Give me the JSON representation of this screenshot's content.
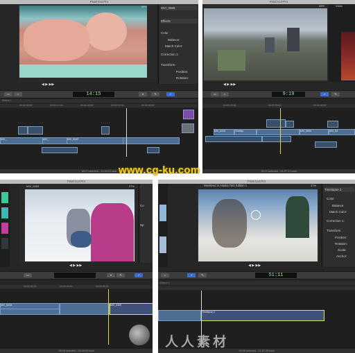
{
  "watermark": {
    "site": "www.cg-ku.com",
    "logo_text": "人人素材"
  },
  "panel_tl": {
    "app_title": "Final Cut Pro",
    "zoom": "46%",
    "inspector": {
      "clip_name": "MVI_0968",
      "section": "Effects",
      "color": "Color",
      "balance": "Balance:",
      "match": "Match Color:",
      "correction": "Correction 1:",
      "transform": "Transform",
      "position": "Position:",
      "rotation": "Rotation:"
    },
    "timecode": "14:15",
    "edition": "Edition 1",
    "ruler": [
      "00:00:00:00",
      "00:00:10:00",
      "00:00:20:00",
      "00:00:30:00",
      "00:00:40:00"
    ],
    "clips": [
      "MVI_",
      "MVI_",
      "MVI_5443"
    ],
    "status": "MVI? selected - 01:04:12 total"
  },
  "panel_tr": {
    "app_title": "Final Cut Pro",
    "zoom": "45%",
    "viewer_label": "Video",
    "timecode": "9:19",
    "ruler": [
      "00:00:20:00",
      "00:00:30:00",
      "00:00:40:00"
    ],
    "clips": [
      "MVI_5418",
      "Timelap",
      "MVI_5600",
      "MVI_54"
    ],
    "status": "26:19 selected - 01:57:12 total"
  },
  "panel_bl": {
    "app_title": "Final Cut Pro",
    "clip_label": "MVI_5469",
    "zoom": "37%",
    "timecode": "",
    "ruler": [
      "00:00:02:00",
      "00:00:04:00",
      "00:00:06:00"
    ],
    "clips": [
      "MVI_5418",
      "MVI_5469"
    ],
    "status": "26:18 selected - 02:49:53 total"
  },
  "panel_br": {
    "app_title": "Final Cut Pro",
    "project_title": "Weekend in Alaska Tutz Edition 1",
    "zoom": "37%",
    "inspector": {
      "title": "Timelapse 2",
      "color": "Color",
      "balance": "Balance:",
      "match": "Match Color:",
      "correction": "Correction 1:",
      "transform": "Transform",
      "position": "Position:",
      "rotation": "Rotation:",
      "scale": "Scale:",
      "anchor": "Anchor:"
    },
    "timecode": "51:11",
    "edition": "Edition 1",
    "clip": "Timelapse 2",
    "status": "09:05 selected - 01:57:20 total"
  }
}
